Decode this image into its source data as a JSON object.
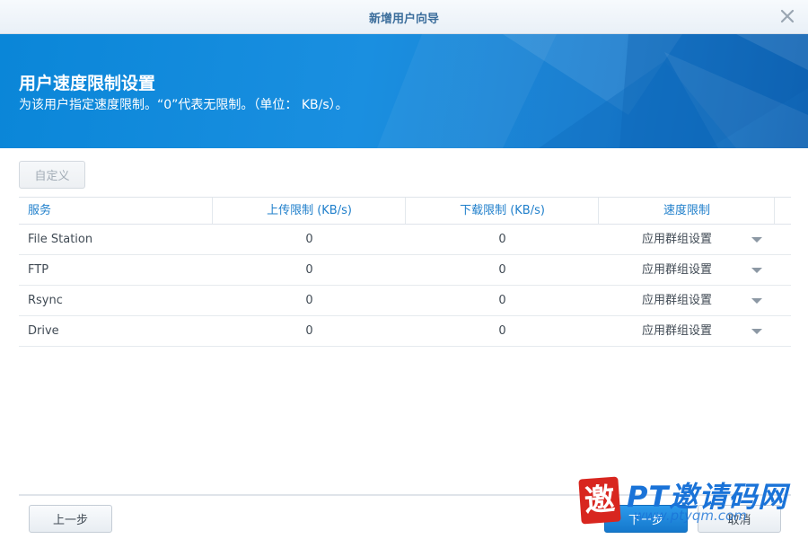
{
  "window": {
    "title": "新增用户向导"
  },
  "banner": {
    "heading": "用户速度限制设置",
    "description": "为该用户指定速度限制。“0”代表无限制。（单位： KB/s）。"
  },
  "toolbar": {
    "custom_label": "自定义"
  },
  "table": {
    "headers": {
      "service": "服务",
      "upload": "上传限制 (KB/s)",
      "download": "下载限制 (KB/s)",
      "speed": "速度限制"
    },
    "rows": [
      {
        "service": "File Station",
        "upload": "0",
        "download": "0",
        "speed": "应用群组设置"
      },
      {
        "service": "FTP",
        "upload": "0",
        "download": "0",
        "speed": "应用群组设置"
      },
      {
        "service": "Rsync",
        "upload": "0",
        "download": "0",
        "speed": "应用群组设置"
      },
      {
        "service": "Drive",
        "upload": "0",
        "download": "0",
        "speed": "应用群组设置"
      }
    ]
  },
  "footer": {
    "back_label": "上一步",
    "next_label": "下一步",
    "cancel_label": "取消"
  },
  "watermark": {
    "seal": "邀",
    "brand": "PT邀请码网",
    "url": "www.ptyqm.com"
  },
  "colors": {
    "accent": "#1a8fe0",
    "header_text": "#1f7fcb",
    "title_text": "#3c6e9c"
  }
}
